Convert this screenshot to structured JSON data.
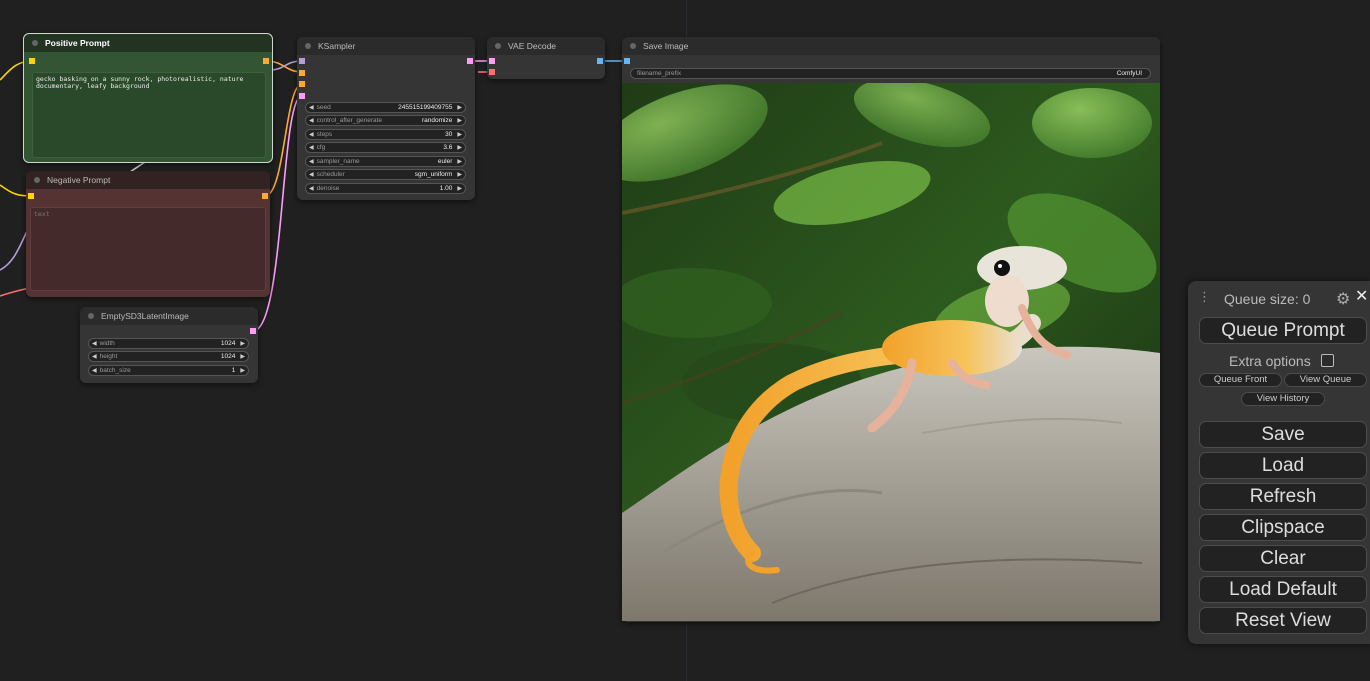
{
  "nodes": {
    "positive_prompt": {
      "title": "Positive Prompt",
      "text": "gecko basking on a sunny rock, photorealistic, nature documentary, leafy background"
    },
    "negative_prompt": {
      "title": "Negative Prompt",
      "placeholder": "text"
    },
    "ksampler": {
      "title": "KSampler",
      "widgets": [
        {
          "label": "seed",
          "value": "245515199409755"
        },
        {
          "label": "control_after_generate",
          "value": "randomize"
        },
        {
          "label": "steps",
          "value": "30"
        },
        {
          "label": "cfg",
          "value": "3.6"
        },
        {
          "label": "sampler_name",
          "value": "euler"
        },
        {
          "label": "scheduler",
          "value": "sgm_uniform"
        },
        {
          "label": "denoise",
          "value": "1.00"
        }
      ]
    },
    "vae_decode": {
      "title": "VAE Decode"
    },
    "save_image": {
      "title": "Save Image",
      "widgets": [
        {
          "label": "filename_prefix",
          "value": "ComfyUI"
        }
      ]
    },
    "empty_latent": {
      "title": "EmptySD3LatentImage",
      "widgets": [
        {
          "label": "width",
          "value": "1024"
        },
        {
          "label": "height",
          "value": "1024"
        },
        {
          "label": "batch_size",
          "value": "1"
        }
      ]
    }
  },
  "menu": {
    "queue_size": "Queue size: 0",
    "queue_prompt": "Queue Prompt",
    "extra_options": "Extra options",
    "queue_front": "Queue Front",
    "view_queue": "View Queue",
    "view_history": "View History",
    "save": "Save",
    "load": "Load",
    "refresh": "Refresh",
    "clipspace": "Clipspace",
    "clear": "Clear",
    "load_default": "Load Default",
    "reset_view": "Reset View"
  },
  "icons": {
    "drag": "drag-handle-icon",
    "gear": "gear-icon",
    "close": "close-icon",
    "arrow_left": "arrow-left-icon",
    "arrow_right": "arrow-right-icon"
  },
  "colors": {
    "canvas_bg": "#202020",
    "node_bg": "#353535",
    "positive_bg": "#335533",
    "negative_bg": "#553333",
    "link_clip": "#FFD500",
    "link_conditioning": "#FFA931",
    "link_latent": "#FF9CF9",
    "link_vae": "#FF6E6E",
    "link_image": "#64B5F6",
    "link_model": "#B39DDB"
  }
}
